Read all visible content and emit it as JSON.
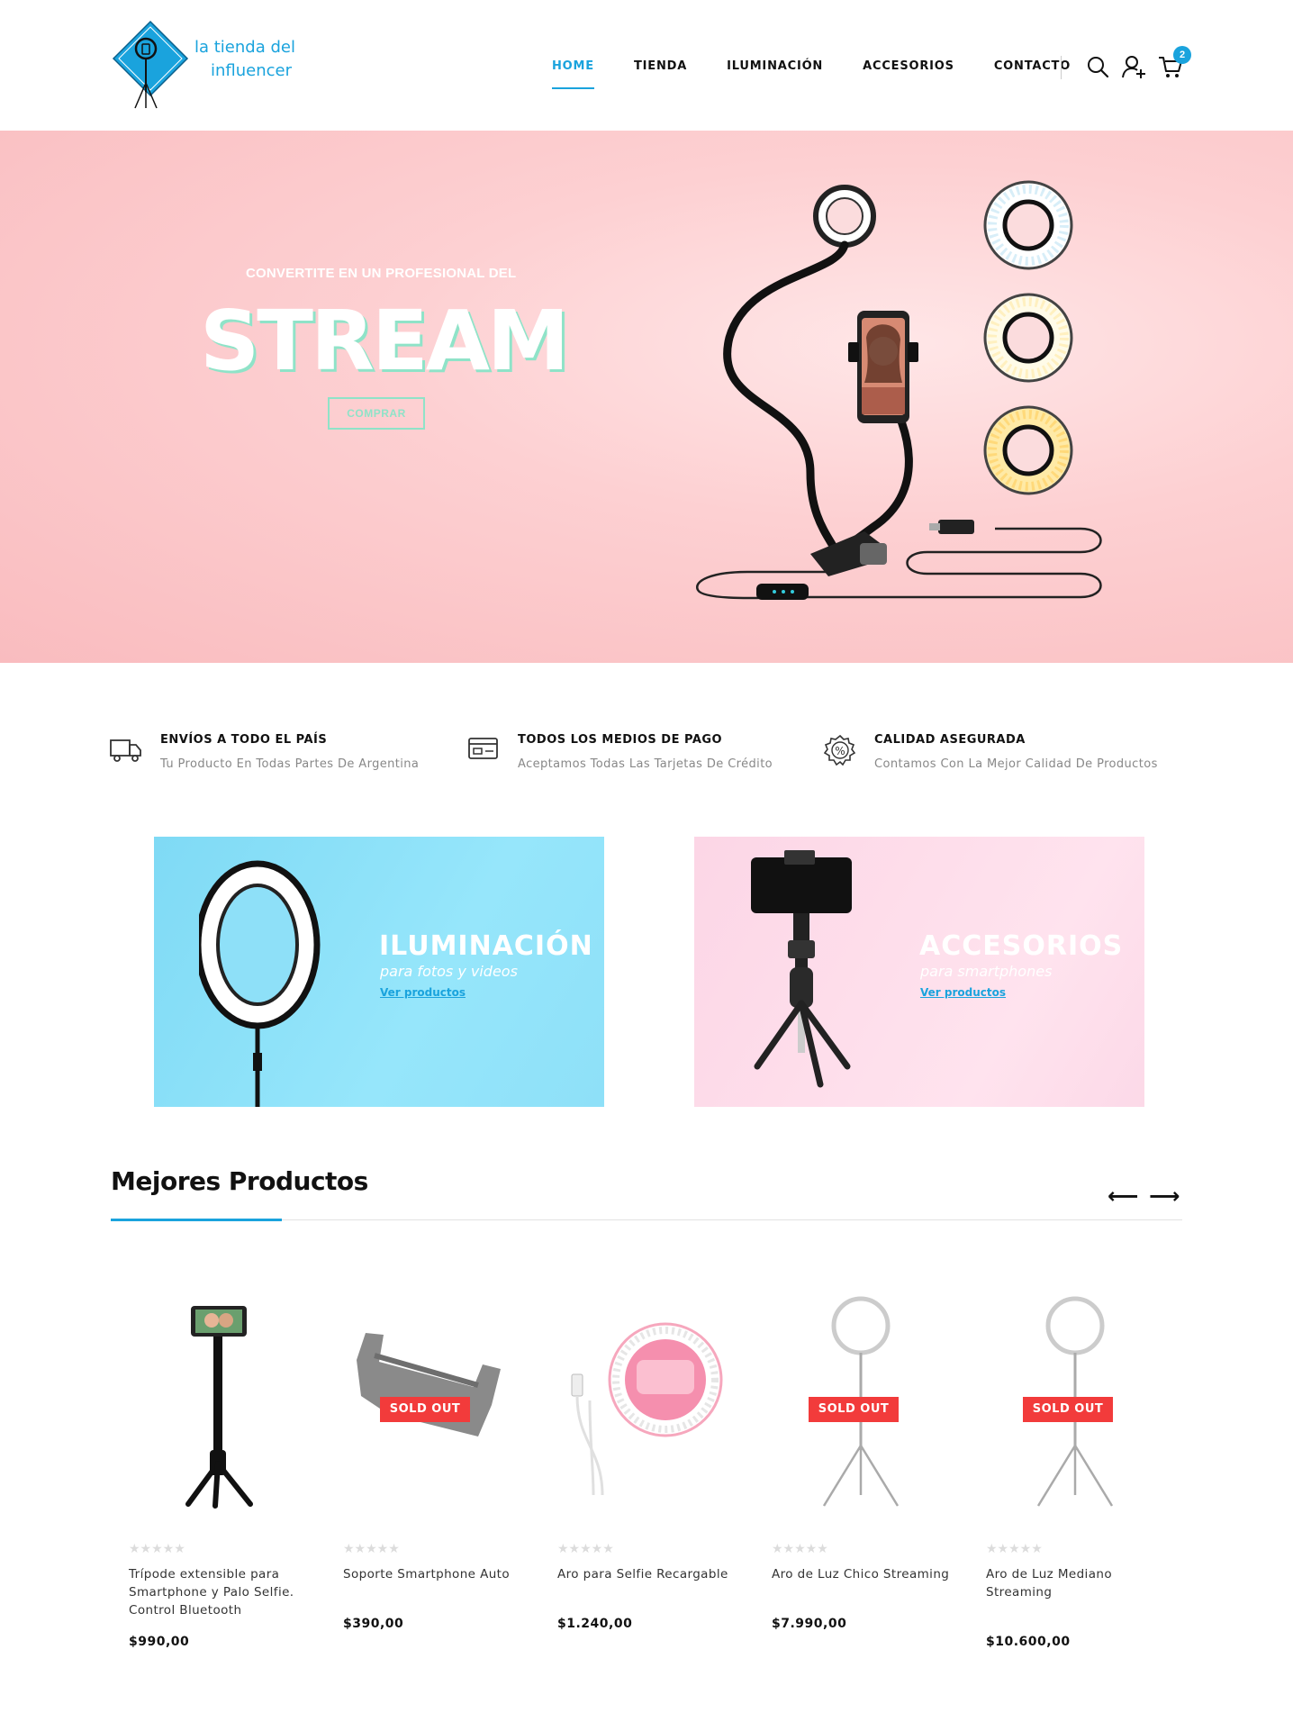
{
  "brand": {
    "line1": "la tienda del",
    "line2": "influencer"
  },
  "nav": {
    "items": [
      {
        "label": "HOME",
        "active": true
      },
      {
        "label": "TIENDA",
        "active": false
      },
      {
        "label": "ILUMINACIÓN",
        "active": false
      },
      {
        "label": "ACCESORIOS",
        "active": false
      },
      {
        "label": "CONTACTO",
        "active": false
      }
    ],
    "icons": [
      "search-icon",
      "user-add-icon",
      "cart-icon"
    ],
    "cart_count": "2"
  },
  "hero": {
    "kicker": "CONVERTITE EN UN PROFESIONAL DEL",
    "title": "STREAM",
    "button": "COMPRAR"
  },
  "features": [
    {
      "icon": "truck-icon",
      "title": "ENVÍOS A TODO EL PAÍS",
      "desc": "Tu Producto En Todas Partes De Argentina"
    },
    {
      "icon": "credit-card-icon",
      "title": "TODOS LOS MEDIOS DE PAGO",
      "desc": "Aceptamos Todas Las Tarjetas De Crédito"
    },
    {
      "icon": "quality-badge-icon",
      "title": "CALIDAD ASEGURADA",
      "desc": "Contamos Con La Mejor Calidad De Productos"
    }
  ],
  "banners": [
    {
      "title": "ILUMINACIÓN",
      "subtitle": "para fotos y videos",
      "link": "Ver productos"
    },
    {
      "title": "ACCESORIOS",
      "subtitle": "para smartphones",
      "link": "Ver productos"
    }
  ],
  "section": {
    "title": "Mejores Productos",
    "prev": "⟵",
    "next": "⟶"
  },
  "products": [
    {
      "name": "Trípode extensible para Smartphone y Palo Selfie. Control Bluetooth",
      "price": "$990,00",
      "sold_out": false,
      "rating": 0
    },
    {
      "name": "Soporte Smartphone Auto",
      "price": "$390,00",
      "sold_out": true,
      "rating": 0
    },
    {
      "name": "Aro para Selfie Recargable",
      "price": "$1.240,00",
      "sold_out": false,
      "rating": 0
    },
    {
      "name": "Aro de Luz Chico Streaming",
      "price": "$7.990,00",
      "sold_out": true,
      "rating": 0
    },
    {
      "name": "Aro de Luz Mediano Streaming",
      "price": "$10.600,00",
      "sold_out": true,
      "rating": 0
    }
  ],
  "labels": {
    "sold_out": "SOLD OUT",
    "stars": "★★★★★"
  },
  "colors": {
    "accent": "#1aa3dd",
    "hero_bg": "#fdd0d2",
    "mint": "#8fe3c8",
    "sold_out": "#f23b3b"
  }
}
